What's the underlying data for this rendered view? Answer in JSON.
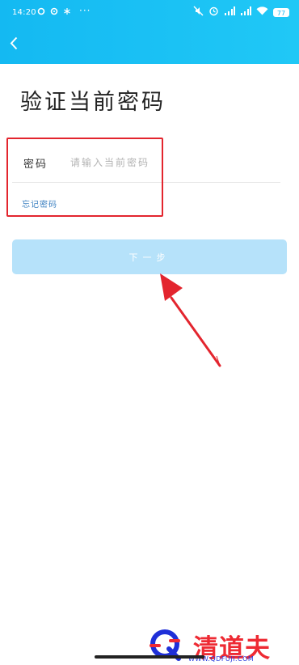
{
  "status_bar": {
    "time": "14:20",
    "more": "···",
    "battery": "77"
  },
  "page": {
    "title": "验证当前密码"
  },
  "form": {
    "password_label": "密码",
    "password_placeholder": "请输入当前密码",
    "forgot_link": "忘记密码"
  },
  "actions": {
    "next_label": "下一步"
  },
  "watermark": {
    "brand": "清道夫",
    "url": "WWW.QDFUJI.COM"
  },
  "colors": {
    "header": "#14b9f2",
    "next_button": "#b6e2fa",
    "annotation": "#e3252e",
    "link": "#3a7fc0"
  }
}
